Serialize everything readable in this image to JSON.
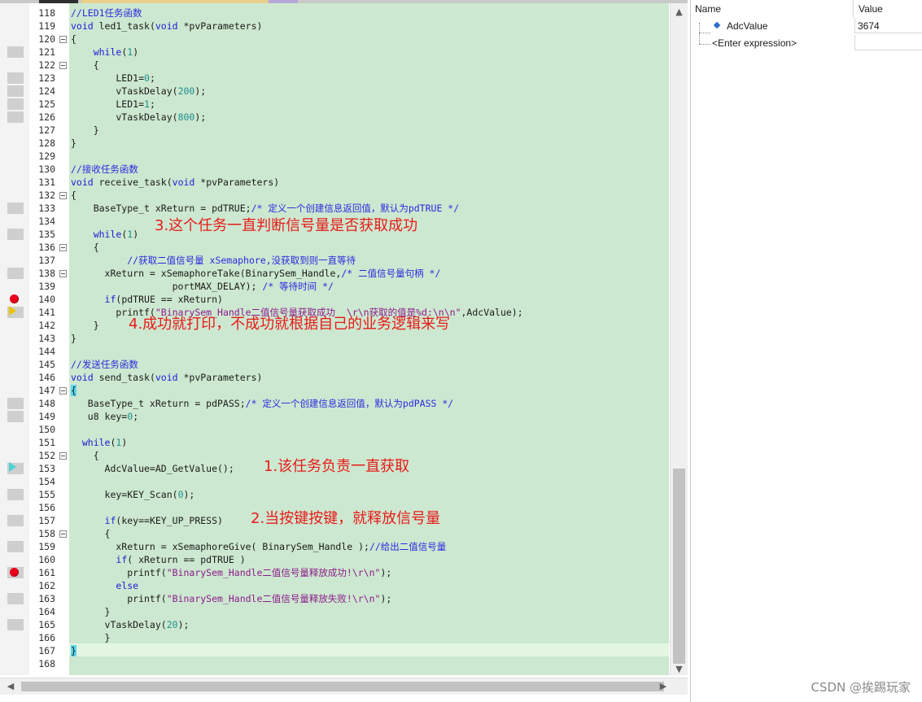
{
  "editor": {
    "lines": [
      {
        "n": "118",
        "html": "<span class='cm'>//LED1任务函数</span>"
      },
      {
        "n": "119",
        "html": "<span class='kw'>void</span> led1_task(<span class='kw'>void</span> *pvParameters)"
      },
      {
        "n": "120",
        "html": "{",
        "fold": true
      },
      {
        "n": "121",
        "html": "    <span class='kw'>while</span>(<span class='num'>1</span>)"
      },
      {
        "n": "122",
        "html": "    {",
        "fold": true
      },
      {
        "n": "123",
        "html": "        LED1=<span class='num'>0</span>;"
      },
      {
        "n": "124",
        "html": "        vTaskDelay(<span class='num'>200</span>);"
      },
      {
        "n": "125",
        "html": "        LED1=<span class='num'>1</span>;"
      },
      {
        "n": "126",
        "html": "        vTaskDelay(<span class='num'>800</span>);"
      },
      {
        "n": "127",
        "html": "    }"
      },
      {
        "n": "128",
        "html": "}"
      },
      {
        "n": "129",
        "html": ""
      },
      {
        "n": "130",
        "html": "<span class='cm'>//接收任务函数</span>"
      },
      {
        "n": "131",
        "html": "<span class='kw'>void</span> receive_task(<span class='kw'>void</span> *pvParameters)"
      },
      {
        "n": "132",
        "html": "{",
        "fold": true
      },
      {
        "n": "133",
        "html": "    BaseType_t xReturn = pdTRUE;<span class='cm'>/* 定义一个创建信息返回值，默认为pdTRUE */</span>"
      },
      {
        "n": "134",
        "html": ""
      },
      {
        "n": "135",
        "html": "    <span class='kw'>while</span>(<span class='num'>1</span>)"
      },
      {
        "n": "136",
        "html": "    {",
        "fold": true
      },
      {
        "n": "137",
        "html": "          <span class='cm'>//获取二值信号量 xSemaphore,没获取到则一直等待</span>"
      },
      {
        "n": "138",
        "html": "      xReturn = xSemaphoreTake(BinarySem_Handle,<span class='cm'>/* 二值信号量句柄 */</span>",
        "fold": true
      },
      {
        "n": "139",
        "html": "                  portMAX_DELAY); <span class='cm'>/* 等待时间 */</span>"
      },
      {
        "n": "140",
        "html": "      <span class='kw'>if</span>(pdTRUE == xReturn)"
      },
      {
        "n": "141",
        "html": "        printf(<span class='str'>\"BinarySem_Handle二值信号量获取成功  \\r\\n获取的值是%d:\\n\\n\"</span>,AdcValue);"
      },
      {
        "n": "142",
        "html": "    }"
      },
      {
        "n": "143",
        "html": "}"
      },
      {
        "n": "144",
        "html": ""
      },
      {
        "n": "145",
        "html": "<span class='cm'>//发送任务函数</span>"
      },
      {
        "n": "146",
        "html": "<span class='kw'>void</span> send_task(<span class='kw'>void</span> *pvParameters)"
      },
      {
        "n": "147",
        "html": "<span class='brace-hl'>{</span>",
        "fold": true
      },
      {
        "n": "148",
        "html": "   BaseType_t xReturn = pdPASS;<span class='cm'>/* 定义一个创建信息返回值，默认为pdPASS */</span>"
      },
      {
        "n": "149",
        "html": "   u8 key=<span class='num'>0</span>;"
      },
      {
        "n": "150",
        "html": ""
      },
      {
        "n": "151",
        "html": "  <span class='kw'>while</span>(<span class='num'>1</span>)"
      },
      {
        "n": "152",
        "html": "    {",
        "fold": true
      },
      {
        "n": "153",
        "html": "      AdcValue=AD_GetValue();"
      },
      {
        "n": "154",
        "html": ""
      },
      {
        "n": "155",
        "html": "      key=KEY_Scan(<span class='num'>0</span>);"
      },
      {
        "n": "156",
        "html": ""
      },
      {
        "n": "157",
        "html": "      <span class='kw'>if</span>(key==KEY_UP_PRESS)"
      },
      {
        "n": "158",
        "html": "      {",
        "fold": true
      },
      {
        "n": "159",
        "html": "        xReturn = xSemaphoreGive( BinarySem_Handle );<span class='cm'>//给出二值信号量</span>"
      },
      {
        "n": "160",
        "html": "        <span class='kw'>if</span>( xReturn == pdTRUE )"
      },
      {
        "n": "161",
        "html": "          printf(<span class='str'>\"BinarySem_Handle二值信号量释放成功!\\r\\n\"</span>);"
      },
      {
        "n": "162",
        "html": "        <span class='kw'>else</span>"
      },
      {
        "n": "163",
        "html": "          printf(<span class='str'>\"BinarySem_Handle二值信号量释放失败!\\r\\n\"</span>);"
      },
      {
        "n": "164",
        "html": "      }"
      },
      {
        "n": "165",
        "html": "      vTaskDelay(<span class='num'>20</span>);"
      },
      {
        "n": "166",
        "html": "      }"
      },
      {
        "n": "167",
        "html": "<span class='brace-hl'>}</span>"
      },
      {
        "n": "168",
        "html": ""
      }
    ],
    "annotations": {
      "a3": "3.这个任务一直判断信号量是否获取成功",
      "a4": "4.成功就打印，不成功就根据自己的业务逻辑来写",
      "a1": "1.该任务负责一直获取",
      "a2": "2.当按键按键，就释放信号量"
    }
  },
  "watch": {
    "col_name": "Name",
    "col_value": "Value",
    "rows": [
      {
        "name": "AdcValue",
        "value": "3674"
      },
      {
        "name": "<Enter expression>",
        "value": ""
      }
    ]
  },
  "watermark": "CSDN @挨踢玩家"
}
